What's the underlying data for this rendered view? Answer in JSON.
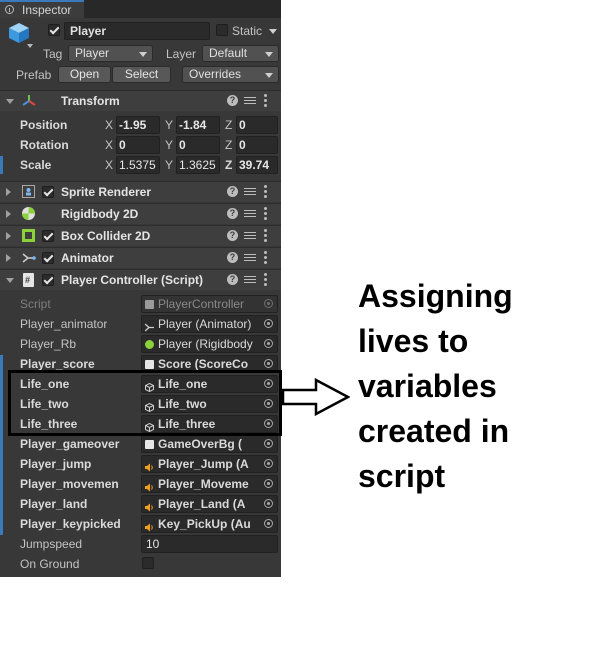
{
  "window": {
    "tab_label": "Inspector"
  },
  "gameobject": {
    "name": "Player",
    "static_label": "Static",
    "tag_label": "Tag",
    "tag_value": "Player",
    "layer_label": "Layer",
    "layer_value": "Default",
    "prefab_label": "Prefab",
    "open_label": "Open",
    "select_label": "Select",
    "overrides_label": "Overrides"
  },
  "transform": {
    "title": "Transform",
    "rows": [
      {
        "label": "Position",
        "x": "-1.95",
        "y": "-1.84",
        "z": "0"
      },
      {
        "label": "Rotation",
        "x": "0",
        "y": "0",
        "z": "0"
      },
      {
        "label": "Scale",
        "x": "1.5375",
        "y": "1.3625",
        "z": "39.74"
      }
    ],
    "axis_x": "X",
    "axis_y": "Y",
    "axis_z": "Z"
  },
  "components": [
    {
      "title": "Sprite Renderer",
      "icon": "sprite-renderer-icon",
      "enabled": true
    },
    {
      "title": "Rigidbody 2D",
      "icon": "rigidbody-icon",
      "enabled": null
    },
    {
      "title": "Box Collider 2D",
      "icon": "box-collider-icon",
      "enabled": true
    },
    {
      "title": "Animator",
      "icon": "animator-icon",
      "enabled": true
    }
  ],
  "script_component": {
    "title": "Player Controller (Script)",
    "fields": [
      {
        "label": "Script",
        "value": "PlayerController",
        "icon": "script-icon",
        "bold": false,
        "dim": true
      },
      {
        "label": "Player_animator",
        "value": "Player (Animator)",
        "icon": "animator-icon",
        "bold": false
      },
      {
        "label": "Player_Rb",
        "value": "Player (Rigidbody",
        "icon": "rigidbody-icon",
        "bold": false
      },
      {
        "label": "Player_score",
        "value": "Score (ScoreCo",
        "icon": "script-icon",
        "bold": true
      },
      {
        "label": "Life_one",
        "value": "Life_one",
        "icon": "gameobject-icon",
        "bold": true
      },
      {
        "label": "Life_two",
        "value": "Life_two",
        "icon": "gameobject-icon",
        "bold": true
      },
      {
        "label": "Life_three",
        "value": "Life_three",
        "icon": "gameobject-icon",
        "bold": true
      },
      {
        "label": "Player_gameover",
        "value": "GameOverBg (",
        "icon": "script-icon",
        "bold": true
      },
      {
        "label": "Player_jump",
        "value": "Player_Jump (A",
        "icon": "audio-icon",
        "bold": true
      },
      {
        "label": "Player_movemen",
        "value": "Player_Moveme",
        "icon": "audio-icon",
        "bold": true
      },
      {
        "label": "Player_land",
        "value": "Player_Land (A",
        "icon": "audio-icon",
        "bold": true
      },
      {
        "label": "Player_keypicked",
        "value": "Key_PickUp (Au",
        "icon": "audio-icon",
        "bold": true
      }
    ],
    "jumpspeed_label": "Jumpspeed",
    "jumpspeed_value": "10",
    "onground_label": "On Ground",
    "onground_value": false
  },
  "annotation": {
    "lines": [
      "Assigning",
      "lives to",
      "variables",
      "created in",
      "script"
    ]
  }
}
